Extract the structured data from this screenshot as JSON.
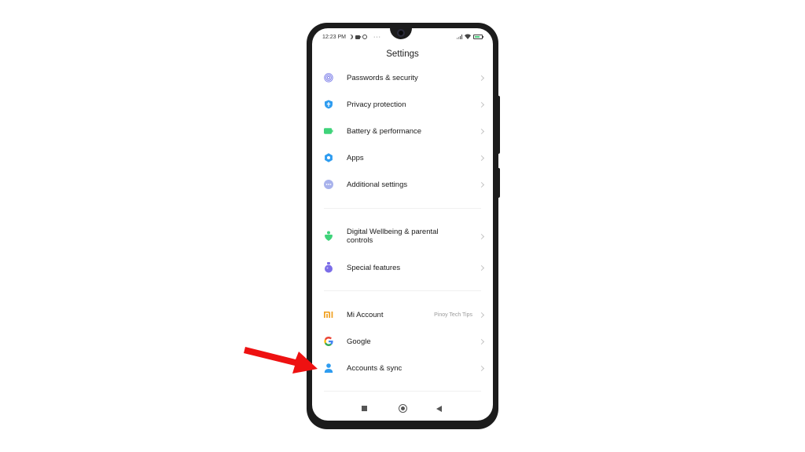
{
  "status_bar": {
    "time": "12:23 PM",
    "more": "···"
  },
  "header": {
    "title": "Settings"
  },
  "groups": [
    {
      "items": [
        {
          "label": "Passwords & security",
          "icon": "fingerprint-icon",
          "color": "#7b7de8"
        },
        {
          "label": "Privacy protection",
          "icon": "privacy-shield-icon",
          "color": "#2e9cf0"
        },
        {
          "label": "Battery & performance",
          "icon": "battery-icon",
          "color": "#3fd37a"
        },
        {
          "label": "Apps",
          "icon": "gear-icon",
          "color": "#2e9cf0"
        },
        {
          "label": "Additional settings",
          "icon": "more-dots-icon",
          "color": "#a8b2ec"
        }
      ]
    },
    {
      "items": [
        {
          "label": "Digital Wellbeing & parental controls",
          "icon": "wellbeing-icon",
          "color": "#3fd37a"
        },
        {
          "label": "Special features",
          "icon": "flask-icon",
          "color": "#7b6de8"
        }
      ]
    },
    {
      "items": [
        {
          "label": "Mi Account",
          "value": "Pinoy Tech Tips",
          "icon": "mi-logo-icon",
          "color": "#f0a020"
        },
        {
          "label": "Google",
          "icon": "google-g-icon",
          "color": "#4285f4"
        },
        {
          "label": "Accounts & sync",
          "icon": "person-icon",
          "color": "#2e9cf0"
        }
      ]
    }
  ],
  "annotation": {
    "arrow_color": "#ee1111",
    "target": "Accounts & sync"
  }
}
